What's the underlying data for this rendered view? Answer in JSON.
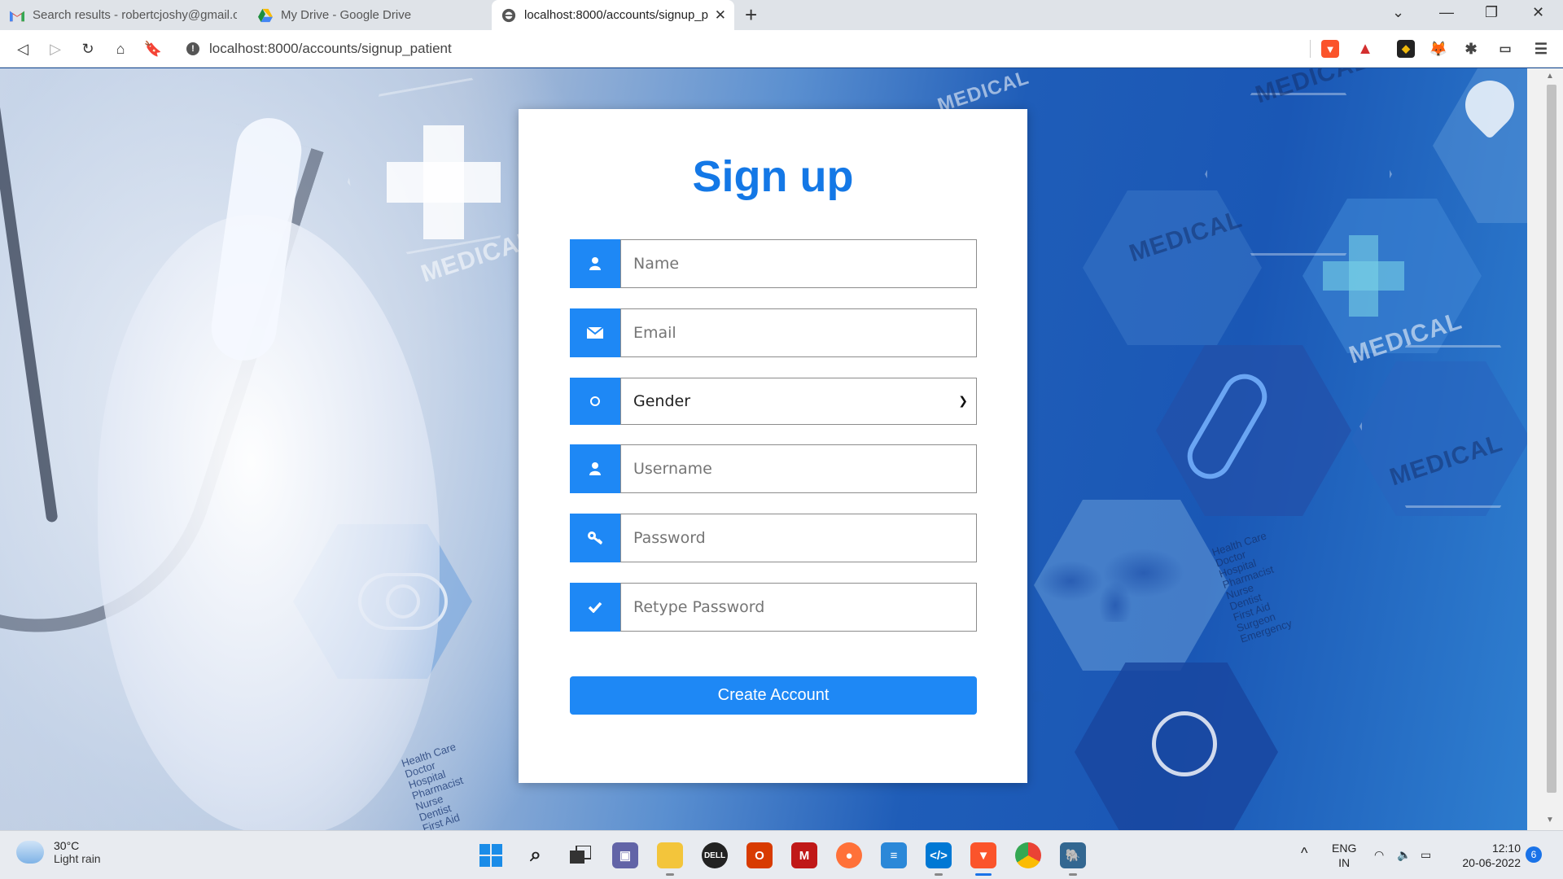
{
  "browser": {
    "tabs": [
      {
        "title": "Search results - robertcjoshy@gmail.c",
        "icon": "gmail-icon"
      },
      {
        "title": "My Drive - Google Drive",
        "icon": "google-drive-icon"
      },
      {
        "title": "localhost:8000/accounts/signup_p",
        "icon": "globe-icon"
      }
    ],
    "url": "localhost:8000/accounts/signup_patient"
  },
  "background": {
    "labels": [
      "MEDICAL",
      "MEDICAL",
      "MEDICAL",
      "MEDICAL",
      "MEDICAL",
      "MEDICAL"
    ],
    "list_left": "Health Care\nDoctor\nHospital\nPharmacist\nNurse\nDentist\nFirst Aid",
    "list_right": "Health Care\nDoctor\nHospital\nPharmacist\nNurse\nDentist\nFirst Aid\nSurgeon\nEmergency"
  },
  "form": {
    "title": "Sign up",
    "name_placeholder": "Name",
    "email_placeholder": "Email",
    "gender_selected": "Gender",
    "username_placeholder": "Username",
    "password_placeholder": "Password",
    "retype_placeholder": "Retype Password",
    "submit_label": "Create Account",
    "accent_color": "#1e88f5"
  },
  "taskbar": {
    "weather_temp": "30°C",
    "weather_desc": "Light rain",
    "lang_line1": "ENG",
    "lang_line2": "IN",
    "time": "12:10",
    "date": "20-06-2022",
    "notification_count": "6"
  }
}
